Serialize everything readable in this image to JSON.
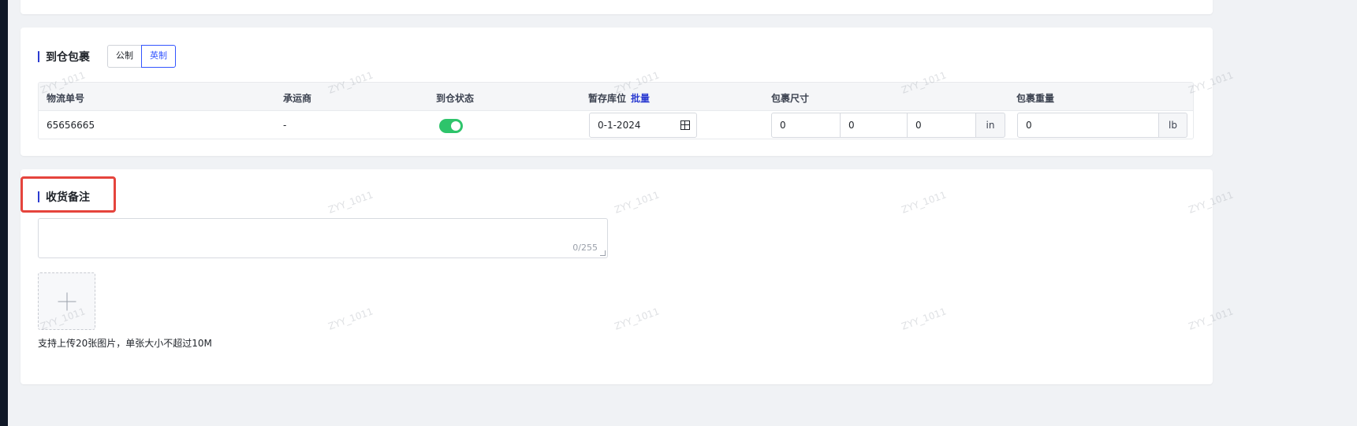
{
  "watermark_text": "ZYY_1011",
  "package_section": {
    "title": "到仓包裹",
    "unit_metric": "公制",
    "unit_imperial": "英制",
    "columns": {
      "tracking_no": "物流单号",
      "carrier": "承运商",
      "arrival_status": "到仓状态",
      "temp_location": "暂存库位",
      "batch": "批量",
      "dimensions": "包裹尺寸",
      "weight": "包裹重量"
    },
    "row": {
      "tracking_no": "65656665",
      "carrier": "-",
      "arrival_status_on": true,
      "temp_location": "0-1-2024",
      "length": "0",
      "width": "0",
      "height": "0",
      "dim_unit": "in",
      "weight": "0",
      "weight_unit": "lb"
    }
  },
  "note_section": {
    "title": "收货备注",
    "textarea_value": "",
    "counter": "0/255",
    "upload_hint": "支持上传20张图片，单张大小不超过10M"
  },
  "colors": {
    "accent": "#3355ff",
    "title_bar": "#2b3bd1",
    "toggle_on": "#2ec46b",
    "highlight": "#e5443d"
  }
}
